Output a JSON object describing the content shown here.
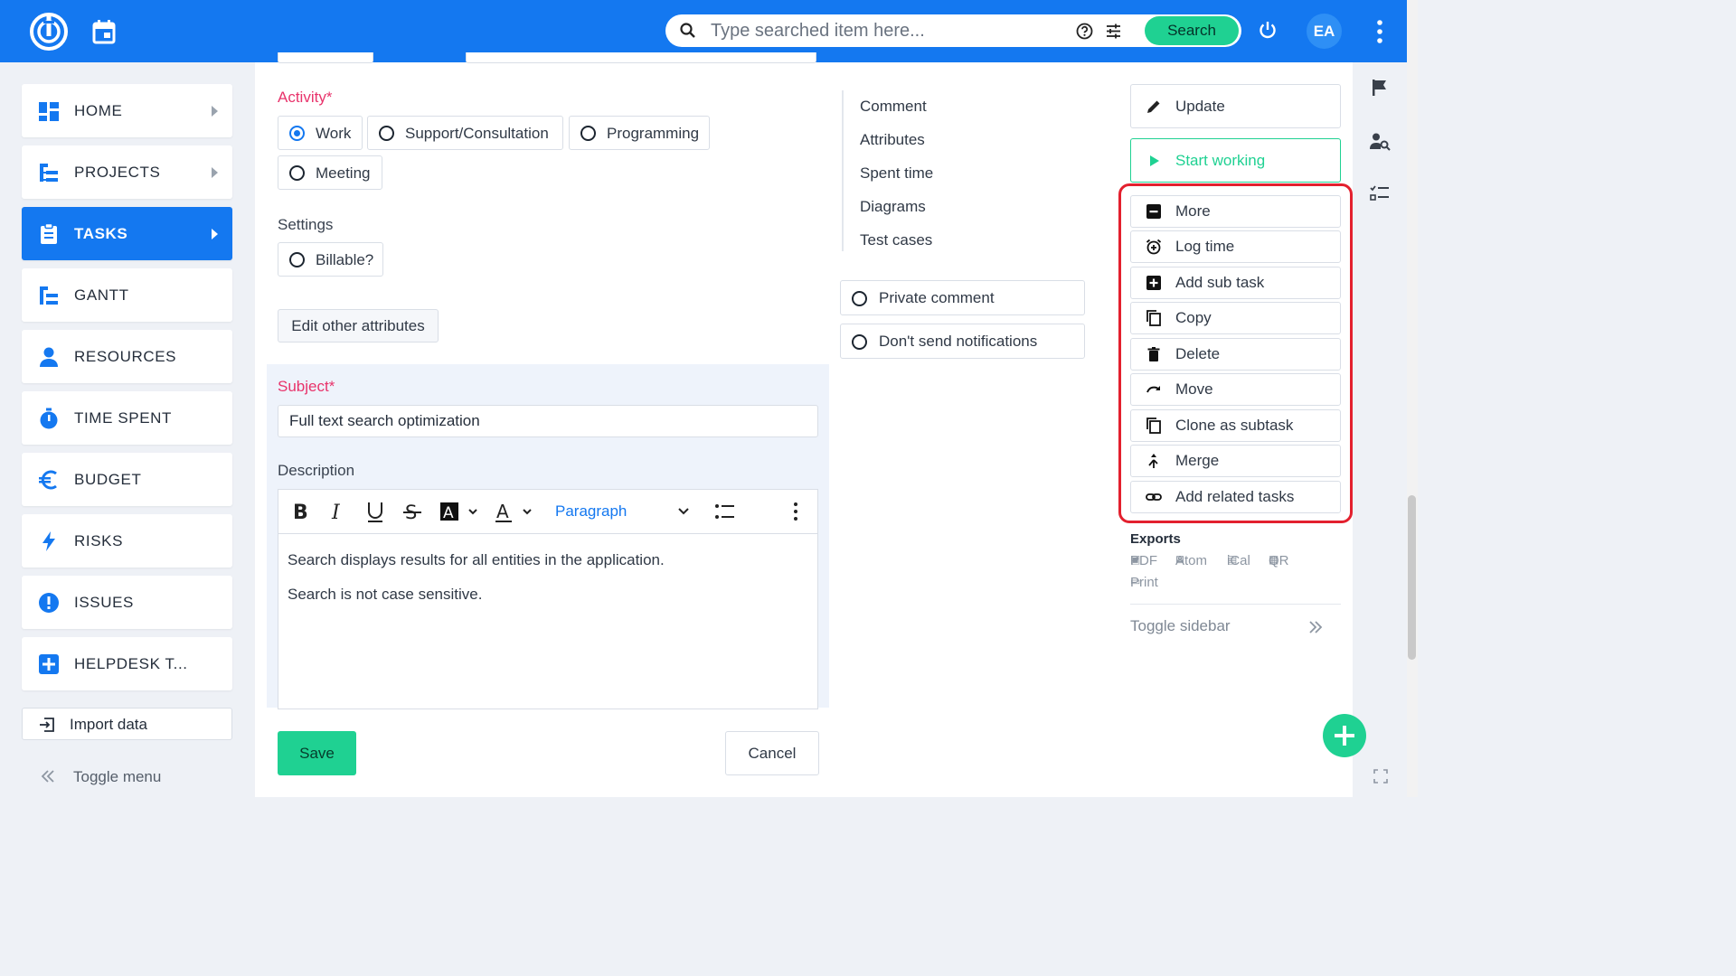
{
  "topbar": {
    "search_placeholder": "Type searched item here...",
    "search_button": "Search",
    "avatar_initials": "EA"
  },
  "sidebar": {
    "items": [
      {
        "label": "HOME",
        "icon": "dashboard-icon"
      },
      {
        "label": "PROJECTS",
        "icon": "projects-tree-icon"
      },
      {
        "label": "TASKS",
        "icon": "clipboard-icon",
        "active": true
      },
      {
        "label": "GANTT",
        "icon": "gantt-icon"
      },
      {
        "label": "RESOURCES",
        "icon": "person-icon"
      },
      {
        "label": "TIME SPENT",
        "icon": "stopwatch-icon"
      },
      {
        "label": "BUDGET",
        "icon": "euro-icon"
      },
      {
        "label": "RISKS",
        "icon": "lightning-icon"
      },
      {
        "label": "ISSUES",
        "icon": "exclamation-icon"
      },
      {
        "label": "HELPDESK T...",
        "icon": "plus-square-icon"
      }
    ],
    "import_label": "Import data",
    "toggle_label": "Toggle menu"
  },
  "form": {
    "activity_label": "Activity*",
    "activity_options": [
      {
        "label": "Work",
        "selected": true
      },
      {
        "label": "Support/Consultation",
        "selected": false
      },
      {
        "label": "Programming",
        "selected": false
      },
      {
        "label": "Meeting",
        "selected": false
      }
    ],
    "settings_label": "Settings",
    "billable_label": "Billable?",
    "edit_attributes_label": "Edit other attributes",
    "subject_label": "Subject*",
    "subject_value": "Full text search optimization",
    "description_label": "Description",
    "editor": {
      "paragraph_select": "Paragraph",
      "body_lines": [
        "Search displays results for all entities in the application.",
        "Search is not case sensitive."
      ]
    },
    "save_label": "Save",
    "cancel_label": "Cancel"
  },
  "tabs": {
    "items": [
      "Comment",
      "Attributes",
      "Spent time",
      "Diagrams",
      "Test cases"
    ],
    "private_comment": "Private comment",
    "dont_send_notifications": "Don't send notifications"
  },
  "actions": {
    "update_label": "Update",
    "start_working_label": "Start working",
    "menu": [
      {
        "label": "More",
        "icon": "minus-square-icon"
      },
      {
        "label": "Log time",
        "icon": "alarm-plus-icon"
      },
      {
        "label": "Add sub task",
        "icon": "plus-square-icon"
      },
      {
        "label": "Copy",
        "icon": "copy-icon"
      },
      {
        "label": "Delete",
        "icon": "trash-icon"
      },
      {
        "label": "Move",
        "icon": "redo-arrow-icon"
      },
      {
        "label": "Clone as subtask",
        "icon": "copy-icon"
      },
      {
        "label": "Merge",
        "icon": "merge-icon"
      },
      {
        "label": "Add related tasks",
        "icon": "link-icon"
      }
    ],
    "exports_title": "Exports",
    "exports": [
      "PDF",
      "Atom",
      "iCal",
      "QR",
      "Print"
    ],
    "toggle_sidebar": "Toggle sidebar"
  },
  "colors": {
    "primary": "#1478f0",
    "accent_green": "#1fd192",
    "required_red": "#e8336b",
    "highlight_red": "#e3202e"
  }
}
